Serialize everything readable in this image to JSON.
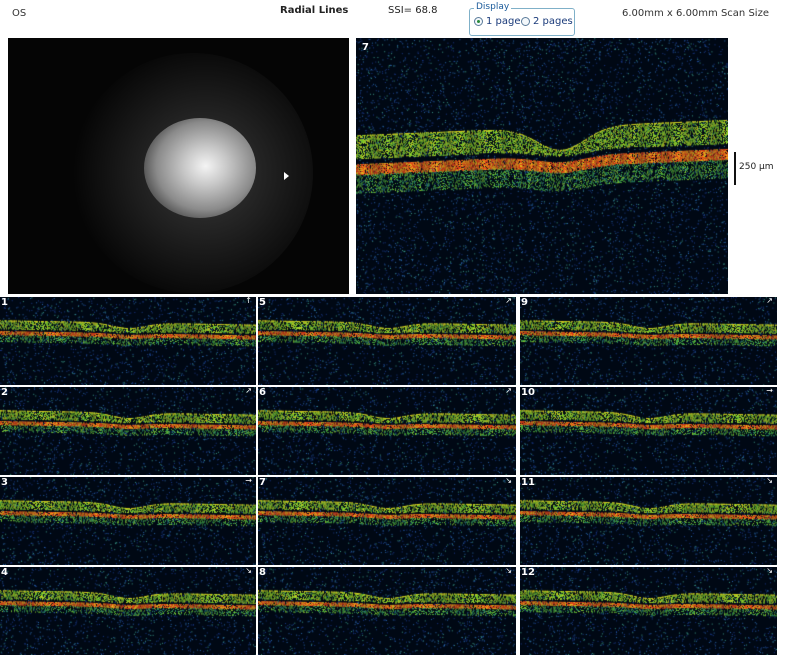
{
  "header": {
    "eye": "OS",
    "scan_type": "Radial Lines",
    "ssi": "SSI= 68.8",
    "scan_size": "6.00mm x 6.00mm Scan Size"
  },
  "display": {
    "legend": "Display",
    "options": [
      {
        "label": "1 page",
        "selected": true
      },
      {
        "label": "2 pages",
        "selected": false
      }
    ]
  },
  "main_scan": {
    "label": "7",
    "scale_label": "250 μm"
  },
  "thumbnails": [
    {
      "label": "1"
    },
    {
      "label": "5"
    },
    {
      "label": "9"
    },
    {
      "label": "2"
    },
    {
      "label": "6"
    },
    {
      "label": "10"
    },
    {
      "label": "3"
    },
    {
      "label": "7"
    },
    {
      "label": "11"
    },
    {
      "label": "4"
    },
    {
      "label": "8"
    },
    {
      "label": "12"
    }
  ],
  "colors": {
    "background": "#000814",
    "retina_green": "#7bc82a",
    "retina_yellow": "#d8d020",
    "rpe_red": "#e0401a",
    "noise_blue": "#2a5aa8"
  }
}
